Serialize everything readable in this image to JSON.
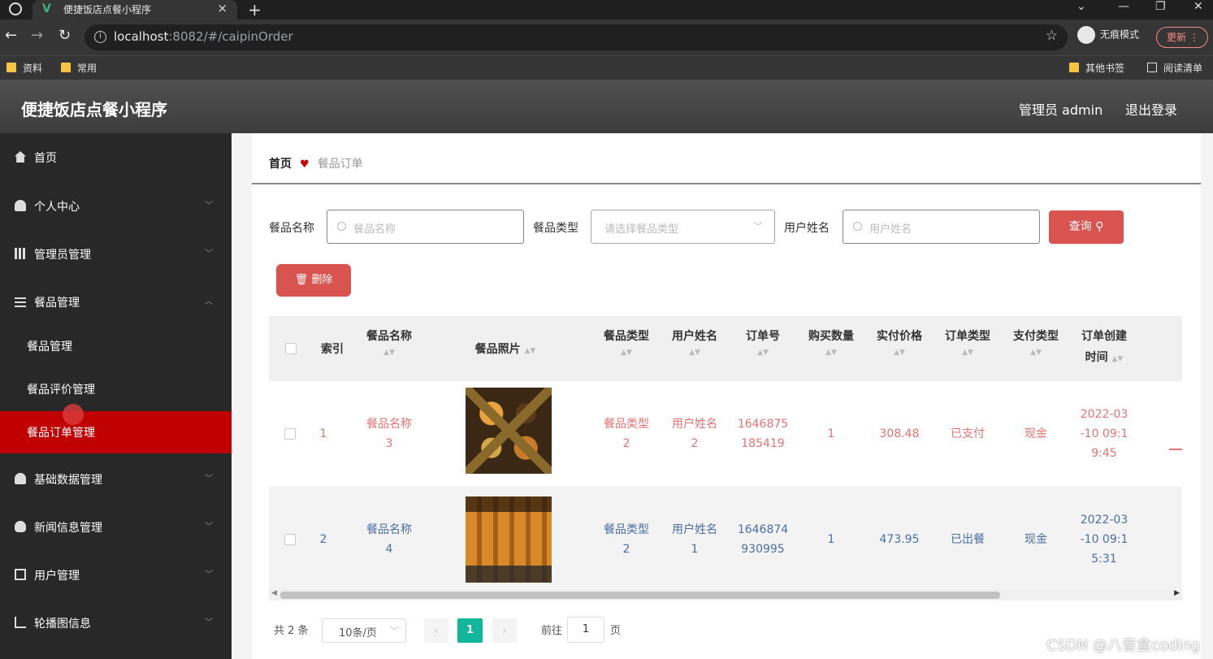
{
  "browser": {
    "tab_title": "便捷饭店点餐小程序",
    "url_host": "localhost",
    "url_rest": ":8082/#/caipinOrder",
    "incognito_label": "无痕模式",
    "update_label": "更新",
    "bookmarks": [
      "资料",
      "常用"
    ],
    "bookmarks_right": [
      "其他书签",
      "阅读清单"
    ]
  },
  "header": {
    "title": "便捷饭店点餐小程序",
    "admin": "管理员 admin",
    "logout": "退出登录"
  },
  "sidebar": {
    "items": [
      {
        "label": "首页",
        "icon": "home-icon"
      },
      {
        "label": "个人中心",
        "icon": "user-icon"
      },
      {
        "label": "管理员管理",
        "icon": "bar-chart-icon"
      },
      {
        "label": "餐品管理",
        "icon": "list-icon"
      },
      {
        "label": "基础数据管理",
        "icon": "user-icon"
      },
      {
        "label": "新闻信息管理",
        "icon": "bulb-icon"
      },
      {
        "label": "用户管理",
        "icon": "box-icon"
      },
      {
        "label": "轮播图信息",
        "icon": "crop-icon"
      }
    ],
    "subitems": [
      "餐品管理",
      "餐品评价管理",
      "餐品订单管理"
    ]
  },
  "breadcrumb": {
    "home": "首页",
    "current": "餐品订单"
  },
  "filters": {
    "name_label": "餐品名称",
    "name_placeholder": "餐品名称",
    "type_label": "餐品类型",
    "type_placeholder": "请选择餐品类型",
    "user_label": "用户姓名",
    "user_placeholder": "用户姓名",
    "query_button": "查询",
    "delete_button": "删除"
  },
  "table": {
    "headers": {
      "index": "索引",
      "name": "餐品名称",
      "photo": "餐品照片",
      "type": "餐品类型",
      "user": "用户姓名",
      "order_no": "订单号",
      "qty": "购买数量",
      "price": "实付价格",
      "order_type": "订单类型",
      "pay_type": "支付类型",
      "created_1": "订单创建",
      "created_2": "时间"
    },
    "rows": [
      {
        "index": "1",
        "name_1": "餐品名称",
        "name_2": "3",
        "type_1": "餐品类型",
        "type_2": "2",
        "user_1": "用户姓名",
        "user_2": "2",
        "order_1": "1646875",
        "order_2": "185419",
        "qty": "1",
        "price": "308.48",
        "order_type": "已支付",
        "pay_type": "现金",
        "time_1": "2022-03",
        "time_2": "-10 09:1",
        "time_3": "9:45"
      },
      {
        "index": "2",
        "name_1": "餐品名称",
        "name_2": "4",
        "type_1": "餐品类型",
        "type_2": "2",
        "user_1": "用户姓名",
        "user_2": "1",
        "order_1": "1646874",
        "order_2": "930995",
        "qty": "1",
        "price": "473.95",
        "order_type": "已出餐",
        "pay_type": "现金",
        "time_1": "2022-03",
        "time_2": "-10 09:1",
        "time_3": "5:31"
      }
    ]
  },
  "pagination": {
    "total": "共 2 条",
    "page_size": "10条/页",
    "current_page": "1",
    "goto_label": "前往",
    "goto_value": "1",
    "goto_suffix": "页"
  },
  "watermark": "CSDN @八音盒coding",
  "colors": {
    "accent": "#d9534f",
    "active_menu": "#c00000",
    "pager_active": "#13b59b"
  }
}
